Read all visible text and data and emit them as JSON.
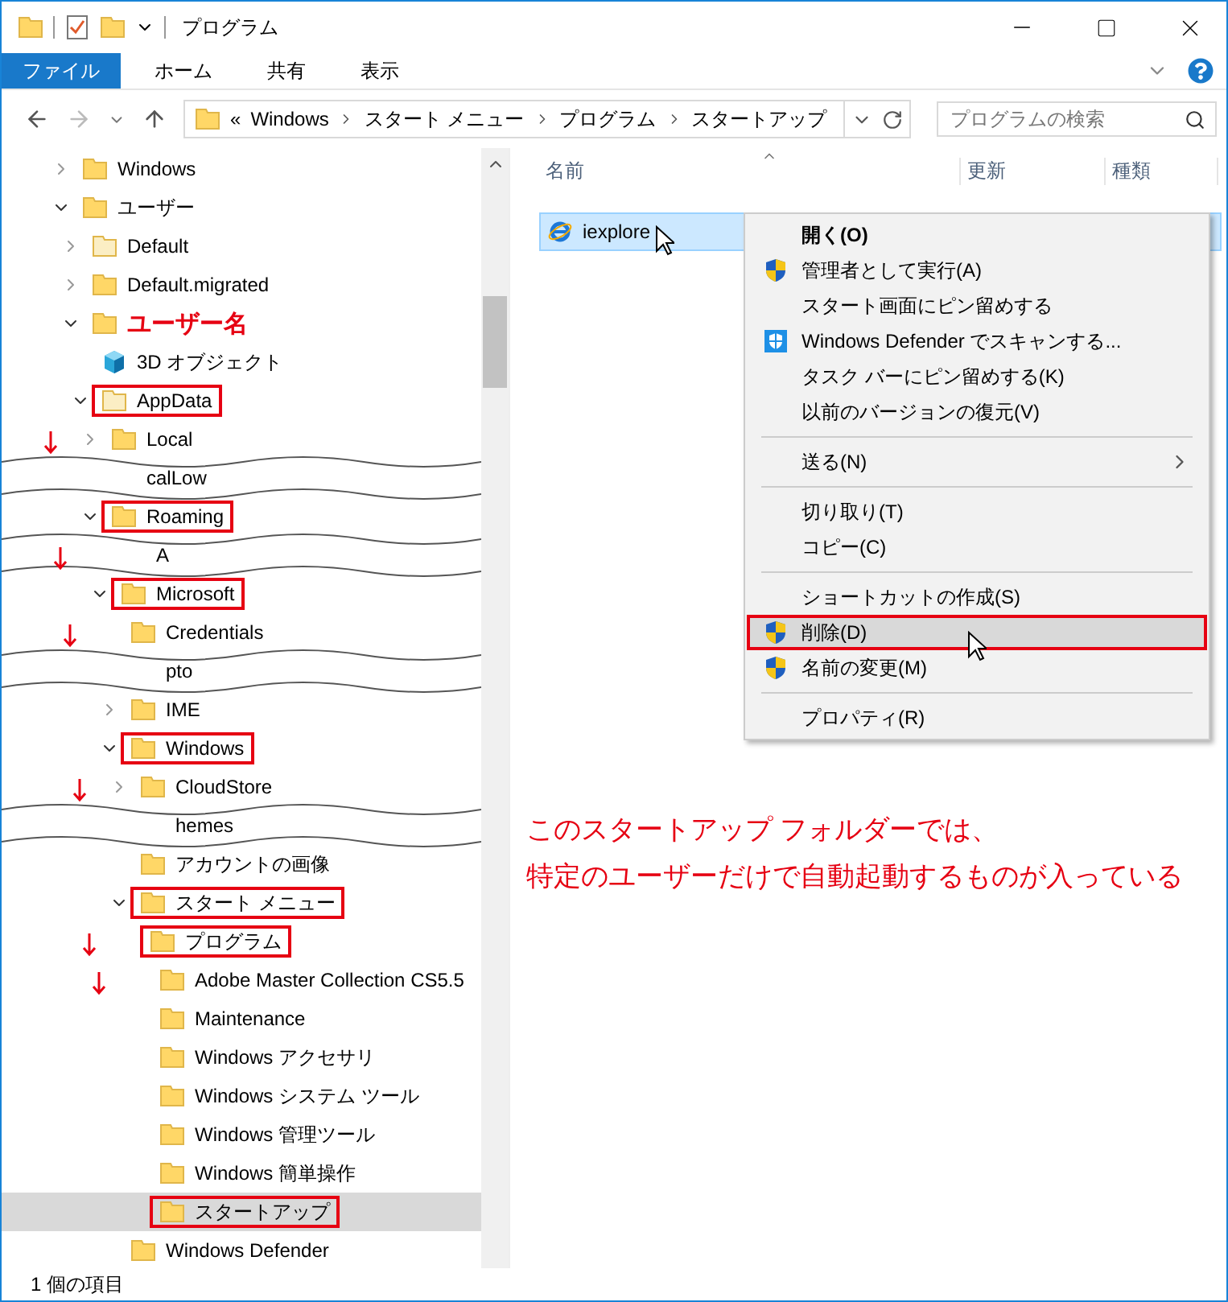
{
  "window": {
    "title": "プログラム"
  },
  "ribbon": {
    "tabs": [
      {
        "label": "ファイル",
        "selected": true
      },
      {
        "label": "ホーム",
        "selected": false
      },
      {
        "label": "共有",
        "selected": false
      },
      {
        "label": "表示",
        "selected": false
      }
    ]
  },
  "address": {
    "overflow": "«",
    "crumbs": [
      "Windows",
      "スタート メニュー",
      "プログラム",
      "スタートアップ"
    ],
    "search": {
      "placeholder": "プログラムの検索"
    }
  },
  "tree": [
    {
      "label": "Windows",
      "kind": "folder",
      "expanded": false
    },
    {
      "label": "ユーザー",
      "kind": "folder",
      "expanded": true,
      "children": [
        {
          "label": "Default",
          "kind": "faint-folder",
          "expanded": false
        },
        {
          "label": "Default.migrated",
          "kind": "folder",
          "expanded": false
        },
        {
          "label": "ユーザー名",
          "kind": "folder",
          "expanded": true,
          "emphasis": true,
          "children": [
            {
              "label": "3D オブジェクト",
              "kind": "cube"
            },
            {
              "label": "AppData",
              "kind": "faint-folder",
              "expanded": true,
              "boxed": true,
              "children": [
                {
                  "label": "Local",
                  "kind": "folder",
                  "expanded": false,
                  "arrow": true
                },
                {
                  "label": "calLow",
                  "kind": "torn"
                },
                {
                  "label": "Roaming",
                  "kind": "folder",
                  "expanded": true,
                  "boxed": true,
                  "children": [
                    {
                      "label": "A",
                      "kind": "torn",
                      "arrow": true
                    },
                    {
                      "label": "Microsoft",
                      "kind": "folder",
                      "expanded": true,
                      "boxed": true,
                      "children": [
                        {
                          "label": "Credentials",
                          "kind": "folder",
                          "arrow": true
                        },
                        {
                          "label": "pto",
                          "kind": "torn"
                        },
                        {
                          "label": "IME",
                          "kind": "folder",
                          "expanded": false
                        },
                        {
                          "label": "Windows",
                          "kind": "folder",
                          "expanded": true,
                          "boxed": true,
                          "children": [
                            {
                              "label": "CloudStore",
                              "kind": "folder",
                              "expanded": false,
                              "arrow": true
                            },
                            {
                              "label": "hemes",
                              "kind": "torn"
                            },
                            {
                              "label": "アカウントの画像",
                              "kind": "folder"
                            },
                            {
                              "label": "スタート メニュー",
                              "kind": "folder",
                              "expanded": true,
                              "boxed": true,
                              "children": [
                                {
                                  "label": "プログラム",
                                  "kind": "folder",
                                  "boxed": true,
                                  "arrow": true,
                                  "children": [
                                    {
                                      "label": "Adobe Master Collection CS5.5",
                                      "kind": "folder",
                                      "arrow": true
                                    },
                                    {
                                      "label": "Maintenance",
                                      "kind": "folder"
                                    },
                                    {
                                      "label": "Windows アクセサリ",
                                      "kind": "folder"
                                    },
                                    {
                                      "label": "Windows システム ツール",
                                      "kind": "folder"
                                    },
                                    {
                                      "label": "Windows 管理ツール",
                                      "kind": "folder"
                                    },
                                    {
                                      "label": "Windows 簡単操作",
                                      "kind": "folder"
                                    },
                                    {
                                      "label": "スタートアップ",
                                      "kind": "folder",
                                      "boxed": true,
                                      "selected": true
                                    }
                                  ]
                                }
                              ]
                            }
                          ]
                        },
                        {
                          "label": "Windows Defender",
                          "kind": "folder"
                        }
                      ]
                    }
                  ]
                }
              ]
            }
          ]
        }
      ]
    }
  ],
  "columns": [
    "名前",
    "更新",
    "種類"
  ],
  "files": [
    {
      "name": "iexplore",
      "selected": true
    }
  ],
  "context_menu": [
    {
      "label": "開く(O)",
      "kind": "plain",
      "default": true,
      "selected": false
    },
    {
      "label": "管理者として実行(A)",
      "kind": "shield",
      "default": false,
      "selected": false
    },
    {
      "label": "スタート画面にピン留めする",
      "kind": "plain",
      "default": false,
      "selected": false
    },
    {
      "label": "Windows Defender でスキャンする...",
      "kind": "defender",
      "default": false,
      "selected": false
    },
    {
      "label": "タスク バーにピン留めする(K)",
      "kind": "plain",
      "default": false,
      "selected": false
    },
    {
      "label": "以前のバージョンの復元(V)",
      "kind": "plain",
      "default": false,
      "selected": false,
      "separator_after": true
    },
    {
      "label": "送る(N)",
      "kind": "plain",
      "default": false,
      "selected": false,
      "submenu": true,
      "separator_after": true
    },
    {
      "label": "切り取り(T)",
      "kind": "plain",
      "default": false,
      "selected": false
    },
    {
      "label": "コピー(C)",
      "kind": "plain",
      "default": false,
      "selected": false,
      "separator_after": true
    },
    {
      "label": "ショートカットの作成(S)",
      "kind": "plain",
      "default": false,
      "selected": false
    },
    {
      "label": "削除(D)",
      "kind": "shield",
      "default": false,
      "selected": true,
      "boxed": true
    },
    {
      "label": "名前の変更(M)",
      "kind": "shield",
      "default": false,
      "selected": false,
      "separator_after": true
    },
    {
      "label": "プロパティ(R)",
      "kind": "plain",
      "default": false,
      "selected": false
    }
  ],
  "note": [
    "このスタートアップ フォルダーでは、",
    "特定のユーザーだけで自動起動するものが入っている"
  ],
  "status_bar": "1 個の項目"
}
